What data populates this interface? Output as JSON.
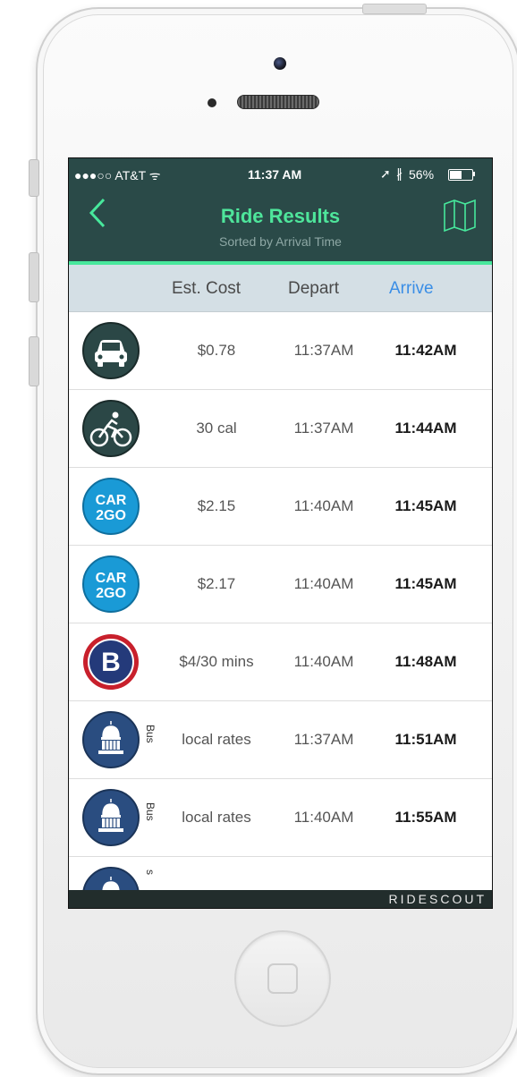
{
  "status_bar": {
    "carrier": "●●●○○ AT&T ᯤ",
    "time": "11:37 AM",
    "battery_pct": "56%",
    "battery_level": 0.56
  },
  "header": {
    "title": "Ride Results",
    "subtitle": "Sorted by Arrival Time"
  },
  "columns": {
    "cost": "Est. Cost",
    "depart": "Depart",
    "arrive": "Arrive"
  },
  "rides": [
    {
      "icon": "car-icon",
      "cost": "$0.78",
      "depart": "11:37AM",
      "arrive": "11:42AM"
    },
    {
      "icon": "bicycle-icon",
      "cost": "30 cal",
      "depart": "11:37AM",
      "arrive": "11:44AM"
    },
    {
      "icon": "car2go-icon",
      "icon_text_1": "CAR",
      "icon_text_2": "2GO",
      "cost": "$2.15",
      "depart": "11:40AM",
      "arrive": "11:45AM"
    },
    {
      "icon": "car2go-icon",
      "icon_text_1": "CAR",
      "icon_text_2": "2GO",
      "cost": "$2.17",
      "depart": "11:40AM",
      "arrive": "11:45AM"
    },
    {
      "icon": "b-cycle-icon",
      "icon_text": "B",
      "cost": "$4/30 mins",
      "depart": "11:40AM",
      "arrive": "11:48AM"
    },
    {
      "icon": "capitol-bus-icon",
      "mode": "Bus",
      "cost": "local rates",
      "depart": "11:37AM",
      "arrive": "11:51AM"
    },
    {
      "icon": "capitol-bus-icon",
      "mode": "Bus",
      "cost": "local rates",
      "depart": "11:40AM",
      "arrive": "11:55AM"
    },
    {
      "icon": "capitol-bus-icon",
      "mode": "s",
      "cost": "",
      "depart": "",
      "arrive": ""
    }
  ],
  "footer": {
    "brand": "RIDESCOUT"
  },
  "colors": {
    "header_bg": "#2a4a48",
    "accent_green": "#47e89c",
    "arrive_blue": "#3a8ee6",
    "car2go_blue": "#1a9ad6",
    "bcycle_red": "#c8202c",
    "bcycle_navy": "#243a7a",
    "capitol_navy": "#2a4d80"
  }
}
